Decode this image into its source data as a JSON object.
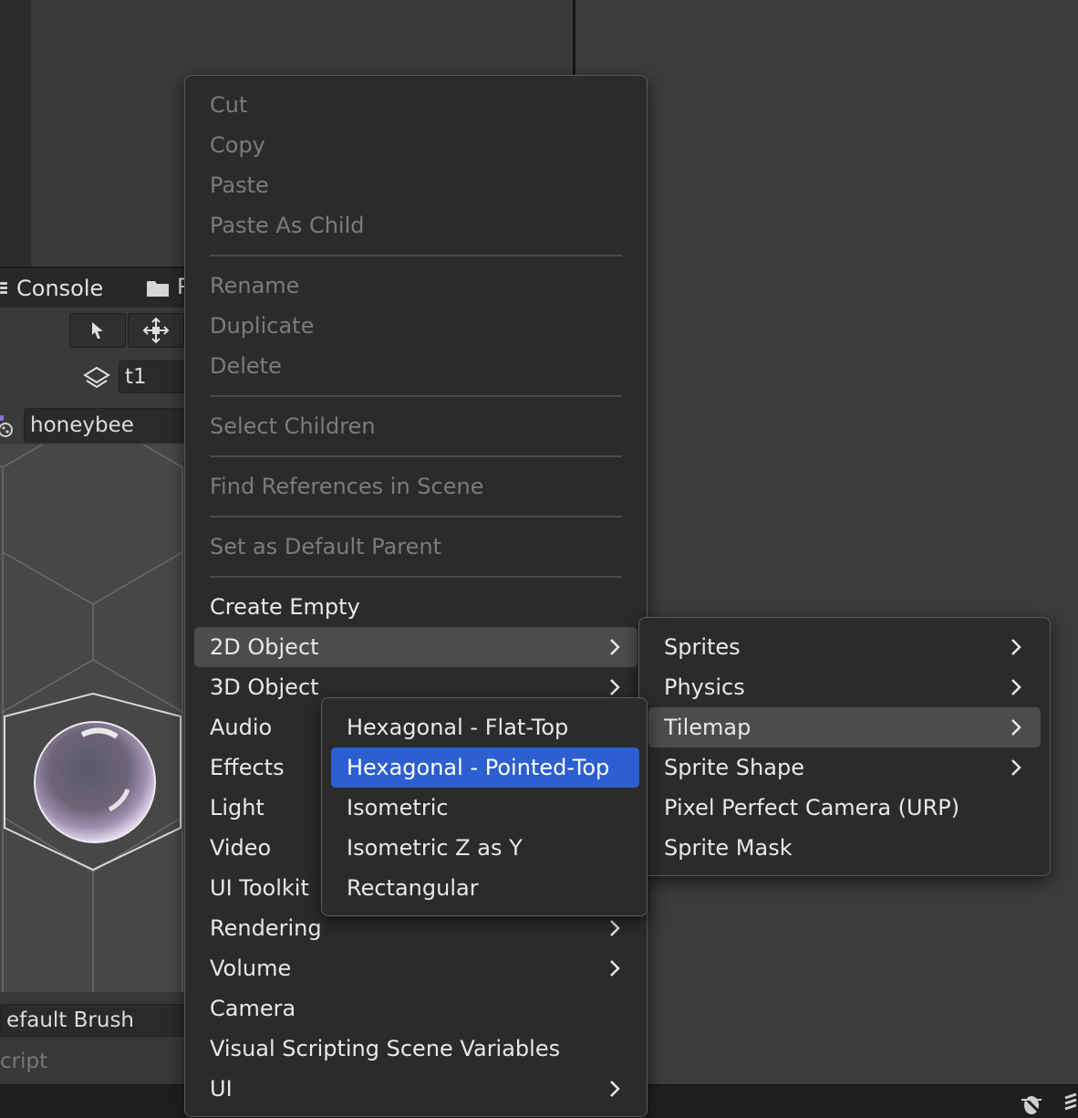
{
  "editor": {
    "console_tab": "Console",
    "project_tab_partial": "P",
    "layer_field": "t1",
    "palette_field": "honeybee",
    "brush_field": "efault Brush",
    "script_label": "cript"
  },
  "context_menu": {
    "group1": [
      "Cut",
      "Copy",
      "Paste",
      "Paste As Child"
    ],
    "group2": [
      "Rename",
      "Duplicate",
      "Delete"
    ],
    "select_children": "Select Children",
    "find_references": "Find References in Scene",
    "set_default_parent": "Set as Default Parent",
    "create_empty": "Create Empty",
    "object_2d": "2D Object",
    "object_3d": "3D Object",
    "audio": "Audio",
    "effects": "Effects",
    "light": "Light",
    "video": "Video",
    "ui_toolkit": "UI Toolkit",
    "rendering": "Rendering",
    "volume": "Volume",
    "camera": "Camera",
    "visual_scripting": "Visual Scripting Scene Variables",
    "ui": "UI"
  },
  "submenu_2d": {
    "sprites": "Sprites",
    "physics": "Physics",
    "tilemap": "Tilemap",
    "sprite_shape": "Sprite Shape",
    "pixel_perfect": "Pixel Perfect Camera (URP)",
    "sprite_mask": "Sprite Mask"
  },
  "submenu_tilemap": {
    "hex_flat": "Hexagonal - Flat-Top",
    "hex_pointed": "Hexagonal - Pointed-Top",
    "isometric": "Isometric",
    "isometric_zy": "Isometric Z as Y",
    "rectangular": "Rectangular"
  },
  "colors": {
    "menu_bg": "#2b2b2b",
    "highlight_gray": "#4c4c4c",
    "highlight_blue": "#2c5fcf",
    "disabled_text": "#7b7b7b"
  }
}
